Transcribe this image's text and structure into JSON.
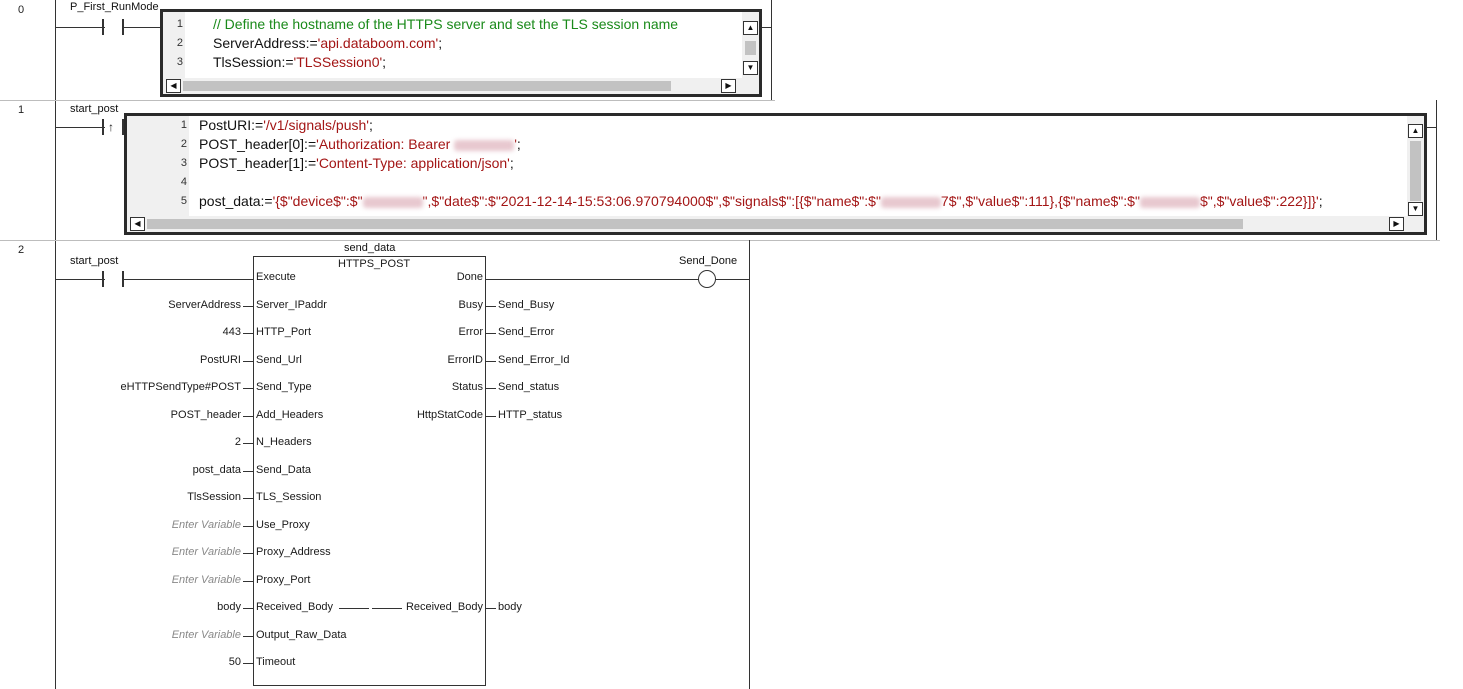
{
  "rungs": [
    {
      "number": "0",
      "contact_label": "P_First_RunMode",
      "code": [
        {
          "ln": "1",
          "parts": [
            {
              "t": "// Define the hostname of the HTTPS server and set the TLS session name",
              "c": "cmt"
            }
          ]
        },
        {
          "ln": "2",
          "parts": [
            {
              "t": "ServerAddress:=",
              "c": "kw"
            },
            {
              "t": "'api.databoom.com'",
              "c": "str"
            },
            {
              "t": ";",
              "c": "kw"
            }
          ]
        },
        {
          "ln": "3",
          "parts": [
            {
              "t": "TlsSession:=",
              "c": "kw"
            },
            {
              "t": "'TLSSession0'",
              "c": "str"
            },
            {
              "t": ";",
              "c": "kw"
            }
          ]
        }
      ]
    },
    {
      "number": "1",
      "contact_label": "start_post",
      "code": [
        {
          "ln": "1",
          "parts": [
            {
              "t": "PostURI:=",
              "c": "kw"
            },
            {
              "t": "'/v1/signals/push'",
              "c": "str"
            },
            {
              "t": ";",
              "c": "kw"
            }
          ]
        },
        {
          "ln": "2",
          "parts": [
            {
              "t": "POST_header[0]:=",
              "c": "kw"
            },
            {
              "t": "'Authorization: Bearer ",
              "c": "str"
            },
            {
              "t": "",
              "c": "blur"
            },
            {
              "t": "'",
              "c": "str"
            },
            {
              "t": ";",
              "c": "kw"
            }
          ]
        },
        {
          "ln": "3",
          "parts": [
            {
              "t": "POST_header[1]:=",
              "c": "kw"
            },
            {
              "t": "'Content-Type: application/json'",
              "c": "str"
            },
            {
              "t": ";",
              "c": "kw"
            }
          ]
        },
        {
          "ln": "4",
          "parts": []
        },
        {
          "ln": "5",
          "parts": [
            {
              "t": "post_data:=",
              "c": "kw"
            },
            {
              "t": "'{$\"device$\":$\"",
              "c": "str"
            },
            {
              "t": "",
              "c": "blur"
            },
            {
              "t": "\",$\"date$\":$\"2021-12-14-15:53:06.970794000$\",$\"signals$\":[{$\"name$\":$\"",
              "c": "str"
            },
            {
              "t": "",
              "c": "blur"
            },
            {
              "t": "7$\",$\"value$\":111},{$\"name$\":$\"",
              "c": "str"
            },
            {
              "t": "",
              "c": "blur"
            },
            {
              "t": "$\",$\"value$\":222}]}'",
              "c": "str"
            },
            {
              "t": ";",
              "c": "kw"
            }
          ]
        }
      ]
    },
    {
      "number": "2",
      "contact_label": "start_post",
      "fb_instance": "send_data",
      "fb_type": "HTTPS_POST",
      "coil_label": "Send_Done",
      "inputs": [
        {
          "var": "",
          "pin": "Execute",
          "placeholder": false
        },
        {
          "var": "ServerAddress",
          "pin": "Server_IPaddr",
          "placeholder": false
        },
        {
          "var": "443",
          "pin": "HTTP_Port",
          "placeholder": false
        },
        {
          "var": "PostURI",
          "pin": "Send_Url",
          "placeholder": false
        },
        {
          "var": "eHTTPSendType#POST",
          "pin": "Send_Type",
          "placeholder": false
        },
        {
          "var": "POST_header",
          "pin": "Add_Headers",
          "placeholder": false
        },
        {
          "var": "2",
          "pin": "N_Headers",
          "placeholder": false
        },
        {
          "var": "post_data",
          "pin": "Send_Data",
          "placeholder": false
        },
        {
          "var": "TlsSession",
          "pin": "TLS_Session",
          "placeholder": false
        },
        {
          "var": "Enter Variable",
          "pin": "Use_Proxy",
          "placeholder": true
        },
        {
          "var": "Enter Variable",
          "pin": "Proxy_Address",
          "placeholder": true
        },
        {
          "var": "Enter Variable",
          "pin": "Proxy_Port",
          "placeholder": true
        },
        {
          "var": "body",
          "pin": "Received_Body",
          "placeholder": false
        },
        {
          "var": "Enter Variable",
          "pin": "Output_Raw_Data",
          "placeholder": true
        },
        {
          "var": "50",
          "pin": "Timeout",
          "placeholder": false
        }
      ],
      "outputs": [
        {
          "pin": "Done",
          "var": ""
        },
        {
          "pin": "Busy",
          "var": "Send_Busy"
        },
        {
          "pin": "Error",
          "var": "Send_Error"
        },
        {
          "pin": "ErrorID",
          "var": "Send_Error_Id"
        },
        {
          "pin": "Status",
          "var": "Send_status"
        },
        {
          "pin": "HttpStatCode",
          "var": "HTTP_status"
        },
        {
          "pin": "",
          "var": ""
        },
        {
          "pin": "",
          "var": ""
        },
        {
          "pin": "",
          "var": ""
        },
        {
          "pin": "",
          "var": ""
        },
        {
          "pin": "",
          "var": ""
        },
        {
          "pin": "",
          "var": ""
        },
        {
          "pin": "Received_Body",
          "var": "body"
        },
        {
          "pin": "",
          "var": ""
        },
        {
          "pin": "",
          "var": ""
        }
      ]
    }
  ],
  "icons": {
    "scroll_up": "▲",
    "scroll_down": "▼",
    "scroll_left": "◀",
    "scroll_right": "▶",
    "rising_edge": "↑"
  }
}
